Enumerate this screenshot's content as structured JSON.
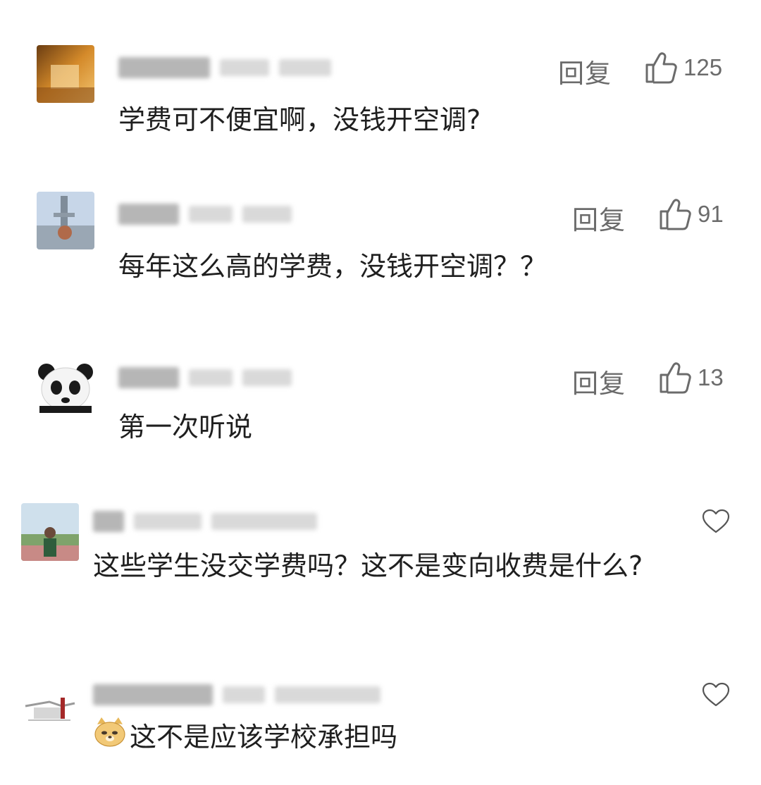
{
  "comments": [
    {
      "text": "学费可不便宜啊，没钱开空调?",
      "reply_label": "回复",
      "likes": "125",
      "avatar": "orange-photo-avatar",
      "action": "like-thumb"
    },
    {
      "text": "每年这么高的学费，没钱开空调？？",
      "reply_label": "回复",
      "likes": "91",
      "avatar": "tower-photo-avatar",
      "action": "like-thumb"
    },
    {
      "text": "第一次听说",
      "reply_label": "回复",
      "likes": "13",
      "avatar": "panda-avatar",
      "action": "like-thumb"
    },
    {
      "text": "这些学生没交学费吗？这不是变向收费是什么?",
      "avatar": "person-photo-avatar",
      "action": "heart-like"
    },
    {
      "text": "这不是应该学校承担吗",
      "emoji": "doge-emoji",
      "avatar": "sketch-avatar",
      "action": "heart-like"
    }
  ],
  "colors": {
    "text": "#1f1f1f",
    "meta": "#6b6b6b",
    "background": "#ffffff"
  }
}
